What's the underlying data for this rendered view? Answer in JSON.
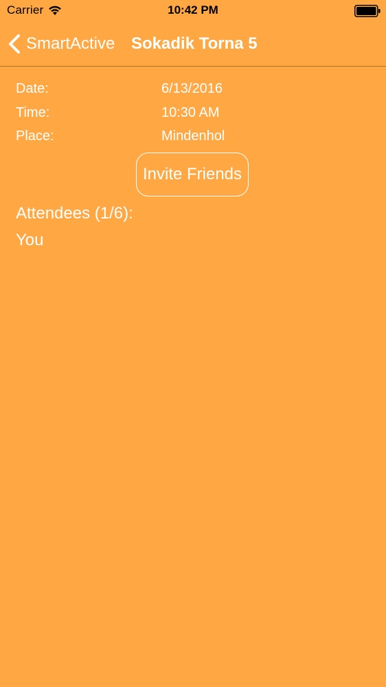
{
  "status_bar": {
    "carrier": "Carrier",
    "wifi_icon": "wifi-icon",
    "time": "10:42 PM",
    "battery_icon": "battery-full-icon"
  },
  "nav": {
    "back_icon": "chevron-left-icon",
    "back_label": "SmartActive",
    "title": "Sokadik Torna 5"
  },
  "event": {
    "date_label": "Date:",
    "date_value": "6/13/2016",
    "time_label": "Time:",
    "time_value": "10:30 AM",
    "place_label": "Place:",
    "place_value": "Mindenhol"
  },
  "invite_button_label": "Invite Friends",
  "attendees": {
    "heading": "Attendees (1/6):",
    "items": [
      "You"
    ]
  },
  "colors": {
    "background": "#FFA743",
    "text": "#ffffff",
    "status_text": "#000000"
  }
}
